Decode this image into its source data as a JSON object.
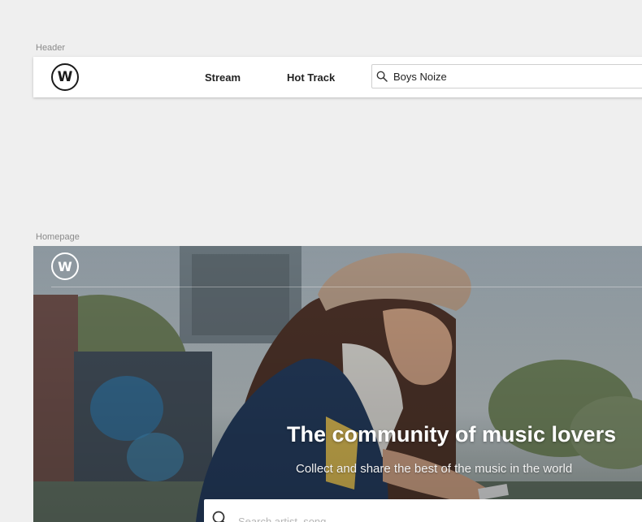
{
  "artboards": {
    "header_label": "Header",
    "homepage_label": "Homepage"
  },
  "header": {
    "logo_letter": "W",
    "nav": [
      {
        "label": "Stream"
      },
      {
        "label": "Hot Track"
      }
    ],
    "search": {
      "value": "Boys Noize",
      "icon": "search-icon"
    }
  },
  "homepage": {
    "logo_letter": "W",
    "hero_title": "The community of music lovers",
    "hero_subtitle": "Collect and share the best of the music in the world",
    "search": {
      "placeholder": "Search artist, song",
      "icon": "search-icon"
    }
  },
  "colors": {
    "background": "#efefef",
    "header_bg": "#ffffff",
    "text_dark": "#222222",
    "hero_text": "#ffffff"
  }
}
